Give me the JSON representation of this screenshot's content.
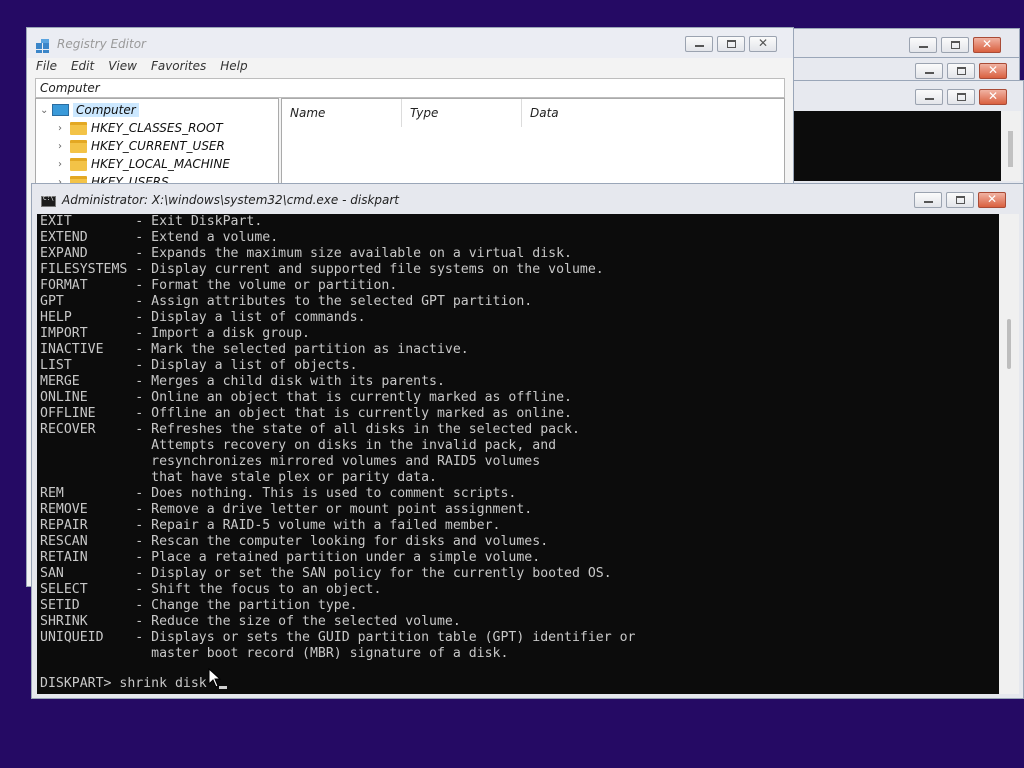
{
  "background_windows": [
    {
      "name": "bg-window-1"
    },
    {
      "name": "bg-window-2"
    },
    {
      "name": "bg-window-3"
    }
  ],
  "regedit": {
    "title": "Registry Editor",
    "menu": [
      "File",
      "Edit",
      "View",
      "Favorites",
      "Help"
    ],
    "address": "Computer",
    "tree": {
      "root": "Computer",
      "keys": [
        "HKEY_CLASSES_ROOT",
        "HKEY_CURRENT_USER",
        "HKEY_LOCAL_MACHINE",
        "HKEY_USERS"
      ]
    },
    "columns": [
      "Name",
      "Type",
      "Data"
    ]
  },
  "cmd": {
    "title": "Administrator: X:\\windows\\system32\\cmd.exe - diskpart",
    "lines": [
      "EXIT        - Exit DiskPart.",
      "EXTEND      - Extend a volume.",
      "EXPAND      - Expands the maximum size available on a virtual disk.",
      "FILESYSTEMS - Display current and supported file systems on the volume.",
      "FORMAT      - Format the volume or partition.",
      "GPT         - Assign attributes to the selected GPT partition.",
      "HELP        - Display a list of commands.",
      "IMPORT      - Import a disk group.",
      "INACTIVE    - Mark the selected partition as inactive.",
      "LIST        - Display a list of objects.",
      "MERGE       - Merges a child disk with its parents.",
      "ONLINE      - Online an object that is currently marked as offline.",
      "OFFLINE     - Offline an object that is currently marked as online.",
      "RECOVER     - Refreshes the state of all disks in the selected pack.",
      "              Attempts recovery on disks in the invalid pack, and",
      "              resynchronizes mirrored volumes and RAID5 volumes",
      "              that have stale plex or parity data.",
      "REM         - Does nothing. This is used to comment scripts.",
      "REMOVE      - Remove a drive letter or mount point assignment.",
      "REPAIR      - Repair a RAID-5 volume with a failed member.",
      "RESCAN      - Rescan the computer looking for disks and volumes.",
      "RETAIN      - Place a retained partition under a simple volume.",
      "SAN         - Display or set the SAN policy for the currently booted OS.",
      "SELECT      - Shift the focus to an object.",
      "SETID       - Change the partition type.",
      "SHRINK      - Reduce the size of the selected volume.",
      "UNIQUEID    - Displays or sets the GUID partition table (GPT) identifier or",
      "              master boot record (MBR) signature of a disk."
    ],
    "prompt": "DISKPART> shrink disk"
  }
}
